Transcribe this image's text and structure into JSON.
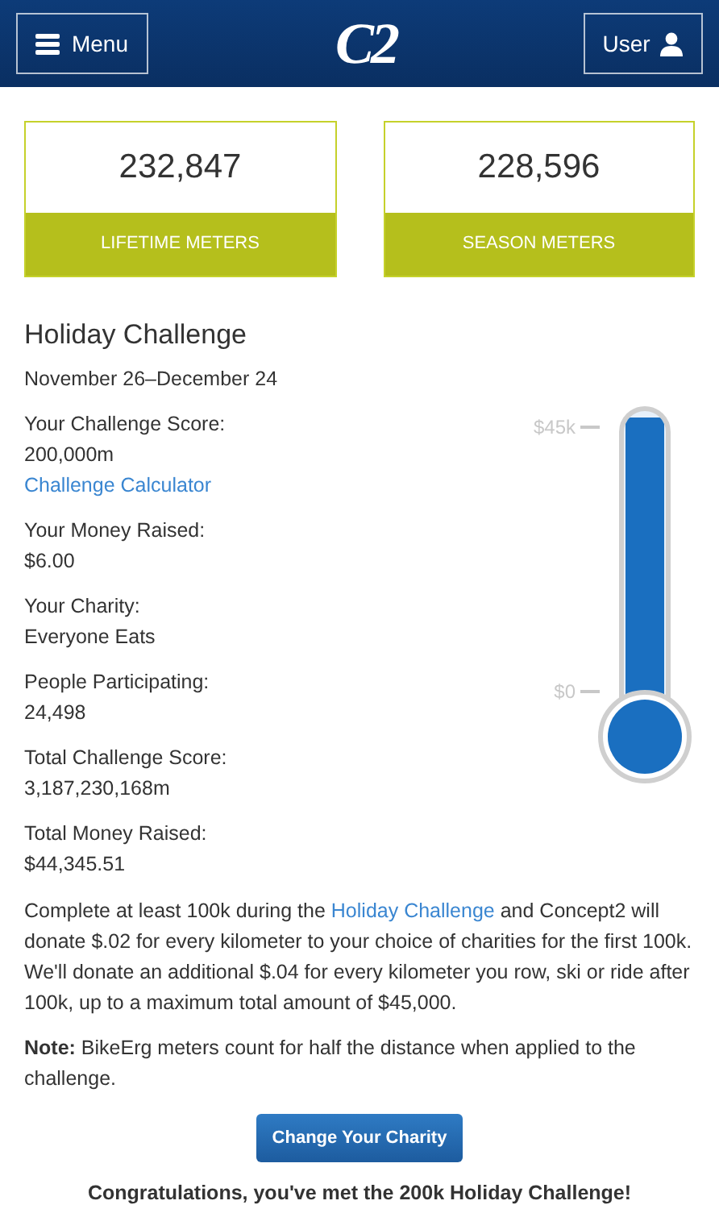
{
  "header": {
    "menu_label": "Menu",
    "logo": "C2",
    "user_label": "User"
  },
  "stat_cards": [
    {
      "value": "232,847",
      "label": "LIFETIME METERS"
    },
    {
      "value": "228,596",
      "label": "SEASON METERS"
    }
  ],
  "challenge": {
    "title": "Holiday Challenge",
    "dates": "November 26–December 24",
    "stats": [
      {
        "label": "Your Challenge Score:",
        "value": "200,000m",
        "link": "Challenge Calculator"
      },
      {
        "label": "Your Money Raised:",
        "value": "$6.00"
      },
      {
        "label": "Your Charity:",
        "value": "Everyone Eats"
      },
      {
        "label": "People Participating:",
        "value": "24,498"
      },
      {
        "label": "Total Challenge Score:",
        "value": "3,187,230,168m"
      },
      {
        "label": "Total Money Raised:",
        "value": "$44,345.51"
      }
    ],
    "thermometer": {
      "top_label": "$45k",
      "bottom_label": "$0",
      "level": 0.985
    },
    "description": {
      "before": "Complete at least 100k during the",
      "link": "Holiday Challenge",
      "after": "and Concept2 will donate $.02 for every kilometer to your choice of charities for the first 100k. We'll donate an additional $.04 for every kilometer you row, ski or ride after 100k, up to a maximum total amount of $45,000."
    },
    "note": "**Note:** BikeErg meters count for half the distance when applied to the challenge.",
    "button": "Change Your Charity",
    "congrats": "Congratulations, you've met the 200k Holiday Challenge!"
  }
}
